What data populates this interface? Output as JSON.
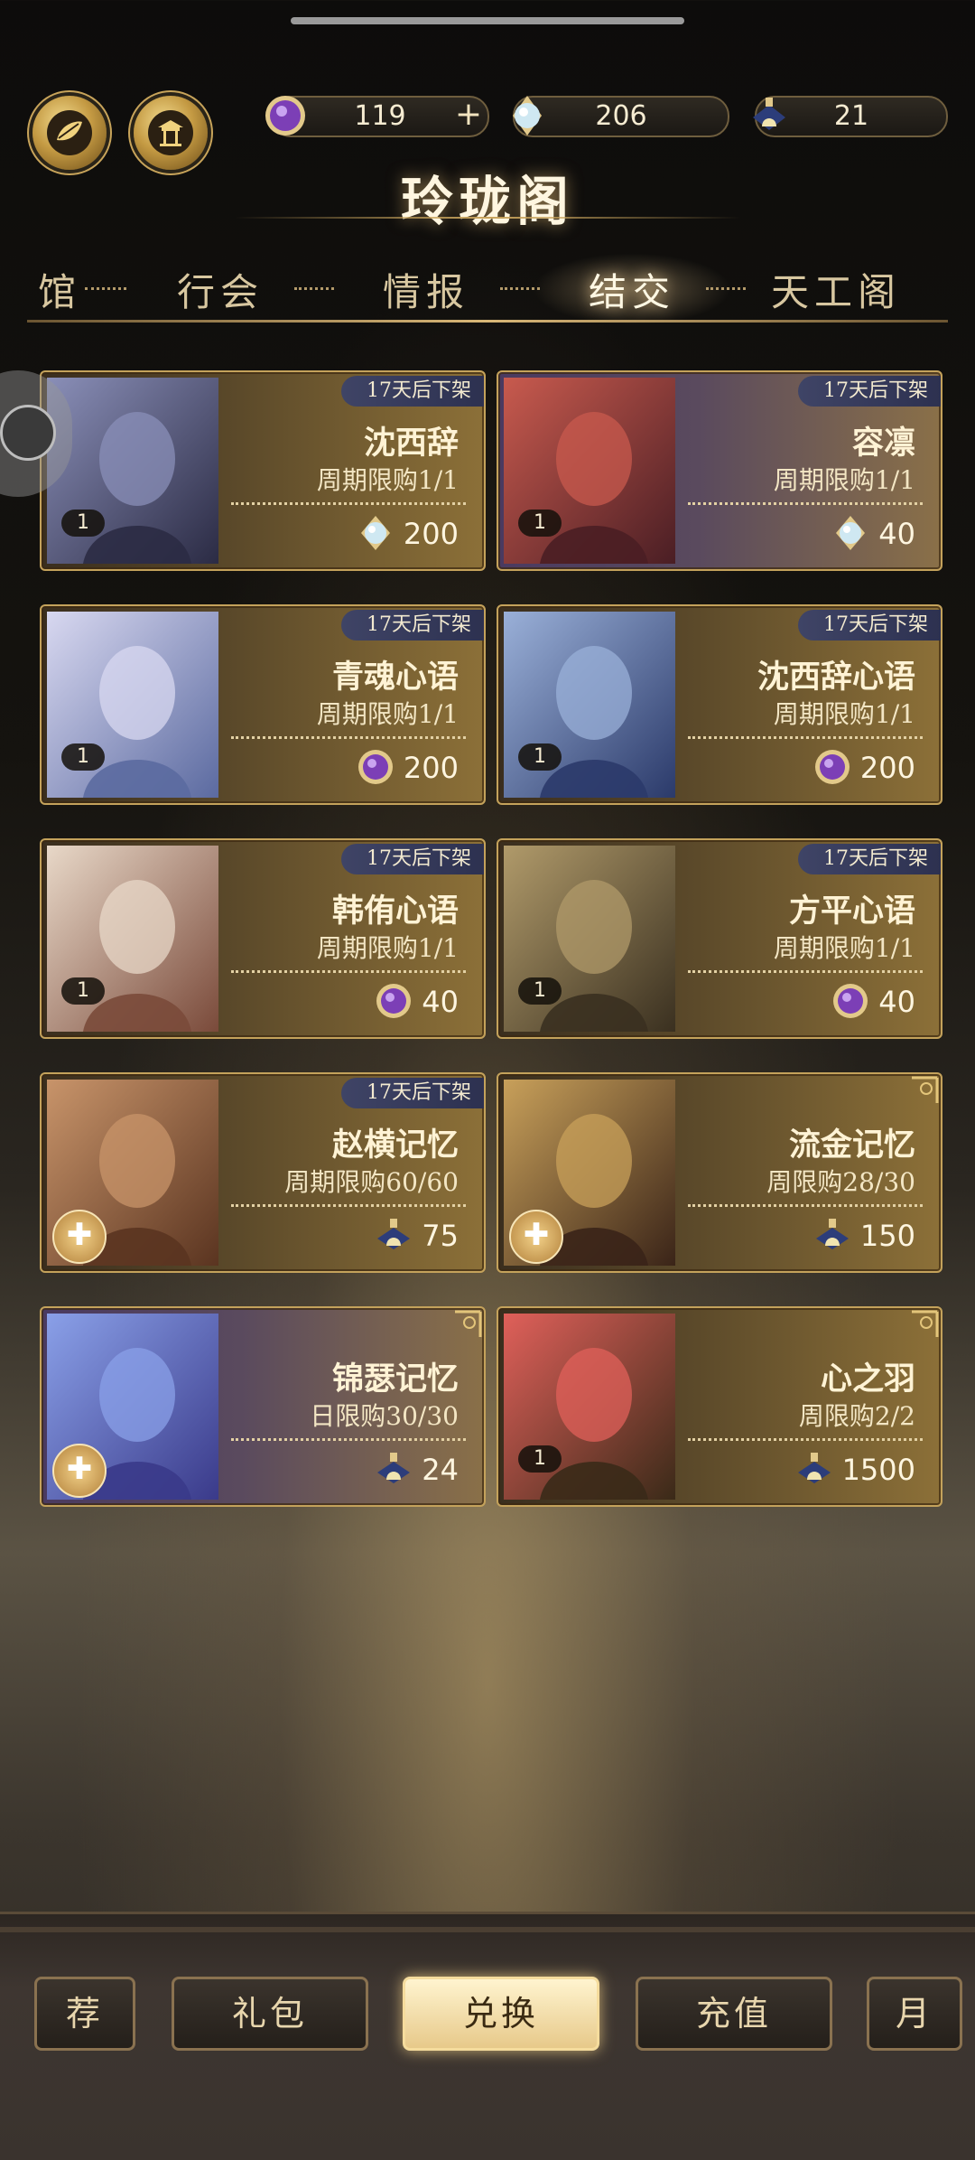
{
  "currencies": {
    "gem": "119",
    "pearl": "206",
    "vial": "21",
    "plus": "+"
  },
  "title": "玲珑阁",
  "tabs": [
    {
      "label": "馆"
    },
    {
      "label": "行会"
    },
    {
      "label": "情报"
    },
    {
      "label": "结交",
      "active": true
    },
    {
      "label": "天工阁"
    }
  ],
  "cards": [
    {
      "timer": "17天后下架",
      "name": "沈西辞",
      "limit": "周期限购1/1",
      "count": "1",
      "price": "200",
      "price_icon": "pearl-icon"
    },
    {
      "timer": "17天后下架",
      "name": "容凛",
      "limit": "周期限购1/1",
      "count": "1",
      "price": "40",
      "price_icon": "pearl-icon"
    },
    {
      "timer": "17天后下架",
      "name": "青魂心语",
      "limit": "周期限购1/1",
      "count": "1",
      "price": "200",
      "price_icon": "gem-icon"
    },
    {
      "timer": "17天后下架",
      "name": "沈西辞心语",
      "limit": "周期限购1/1",
      "count": "1",
      "price": "200",
      "price_icon": "gem-icon"
    },
    {
      "timer": "17天后下架",
      "name": "韩侑心语",
      "limit": "周期限购1/1",
      "count": "1",
      "price": "40",
      "price_icon": "gem-icon"
    },
    {
      "timer": "17天后下架",
      "name": "方平心语",
      "limit": "周期限购1/1",
      "count": "1",
      "price": "40",
      "price_icon": "gem-icon"
    },
    {
      "timer": "17天后下架",
      "name": "赵横记忆",
      "limit": "周期限购60/60",
      "price": "75",
      "price_icon": "vial-icon"
    },
    {
      "name": "流金记忆",
      "limit": "周限购28/30",
      "price": "150",
      "price_icon": "vial-icon"
    },
    {
      "name": "锦瑟记忆",
      "limit": "日限购30/30",
      "price": "24",
      "price_icon": "vial-icon"
    },
    {
      "name": "心之羽",
      "limit": "周限购2/2",
      "count": "1",
      "price": "1500",
      "price_icon": "vial-icon"
    }
  ],
  "bottom_nav": [
    {
      "label": "荐"
    },
    {
      "label": "礼包"
    },
    {
      "label": "兑换",
      "active": true
    },
    {
      "label": "充值"
    },
    {
      "label": "月"
    }
  ],
  "colors": {
    "gold": "#c4a25b",
    "timer_bg": "#3f4466",
    "active_nav": "#e7c98a"
  }
}
